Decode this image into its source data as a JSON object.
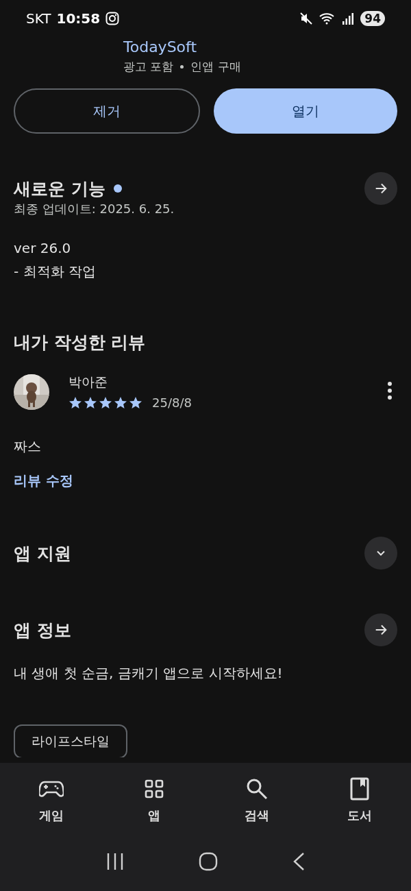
{
  "status_bar": {
    "carrier": "SKT",
    "time": "10:58",
    "battery": "94"
  },
  "app": {
    "developer": "TodaySoft",
    "notes": [
      "광고 포함",
      "인앱 구매"
    ]
  },
  "actions": [
    {
      "label": "제거",
      "kind": "outline"
    },
    {
      "label": "열기",
      "kind": "filled"
    }
  ],
  "whats_new": {
    "title": "새로운 기능",
    "unread": true,
    "updated": "최종 업데이트: 2025. 6. 25.",
    "lines": [
      "ver 26.0",
      "- 최적화 작업"
    ]
  },
  "my_review": {
    "title": "내가 작성한 리뷰",
    "author": "박아준",
    "stars": 5,
    "date": "25/8/8",
    "text": "짜스",
    "edit_link": "리뷰 수정"
  },
  "sections": [
    {
      "title": "앱 지원",
      "kind": "expand"
    },
    {
      "title": "앱 정보",
      "kind": "arrow"
    }
  ],
  "app_info": {
    "description": "내 생애 첫 순금, 금캐기 앱으로 시작하세요!",
    "tags": [
      "라이프스타일"
    ]
  },
  "bottom_nav": [
    {
      "label": "게임",
      "kind": "game"
    },
    {
      "label": "앱",
      "kind": "apps"
    },
    {
      "label": "검색",
      "kind": "search"
    },
    {
      "label": "도서",
      "kind": "book"
    }
  ]
}
